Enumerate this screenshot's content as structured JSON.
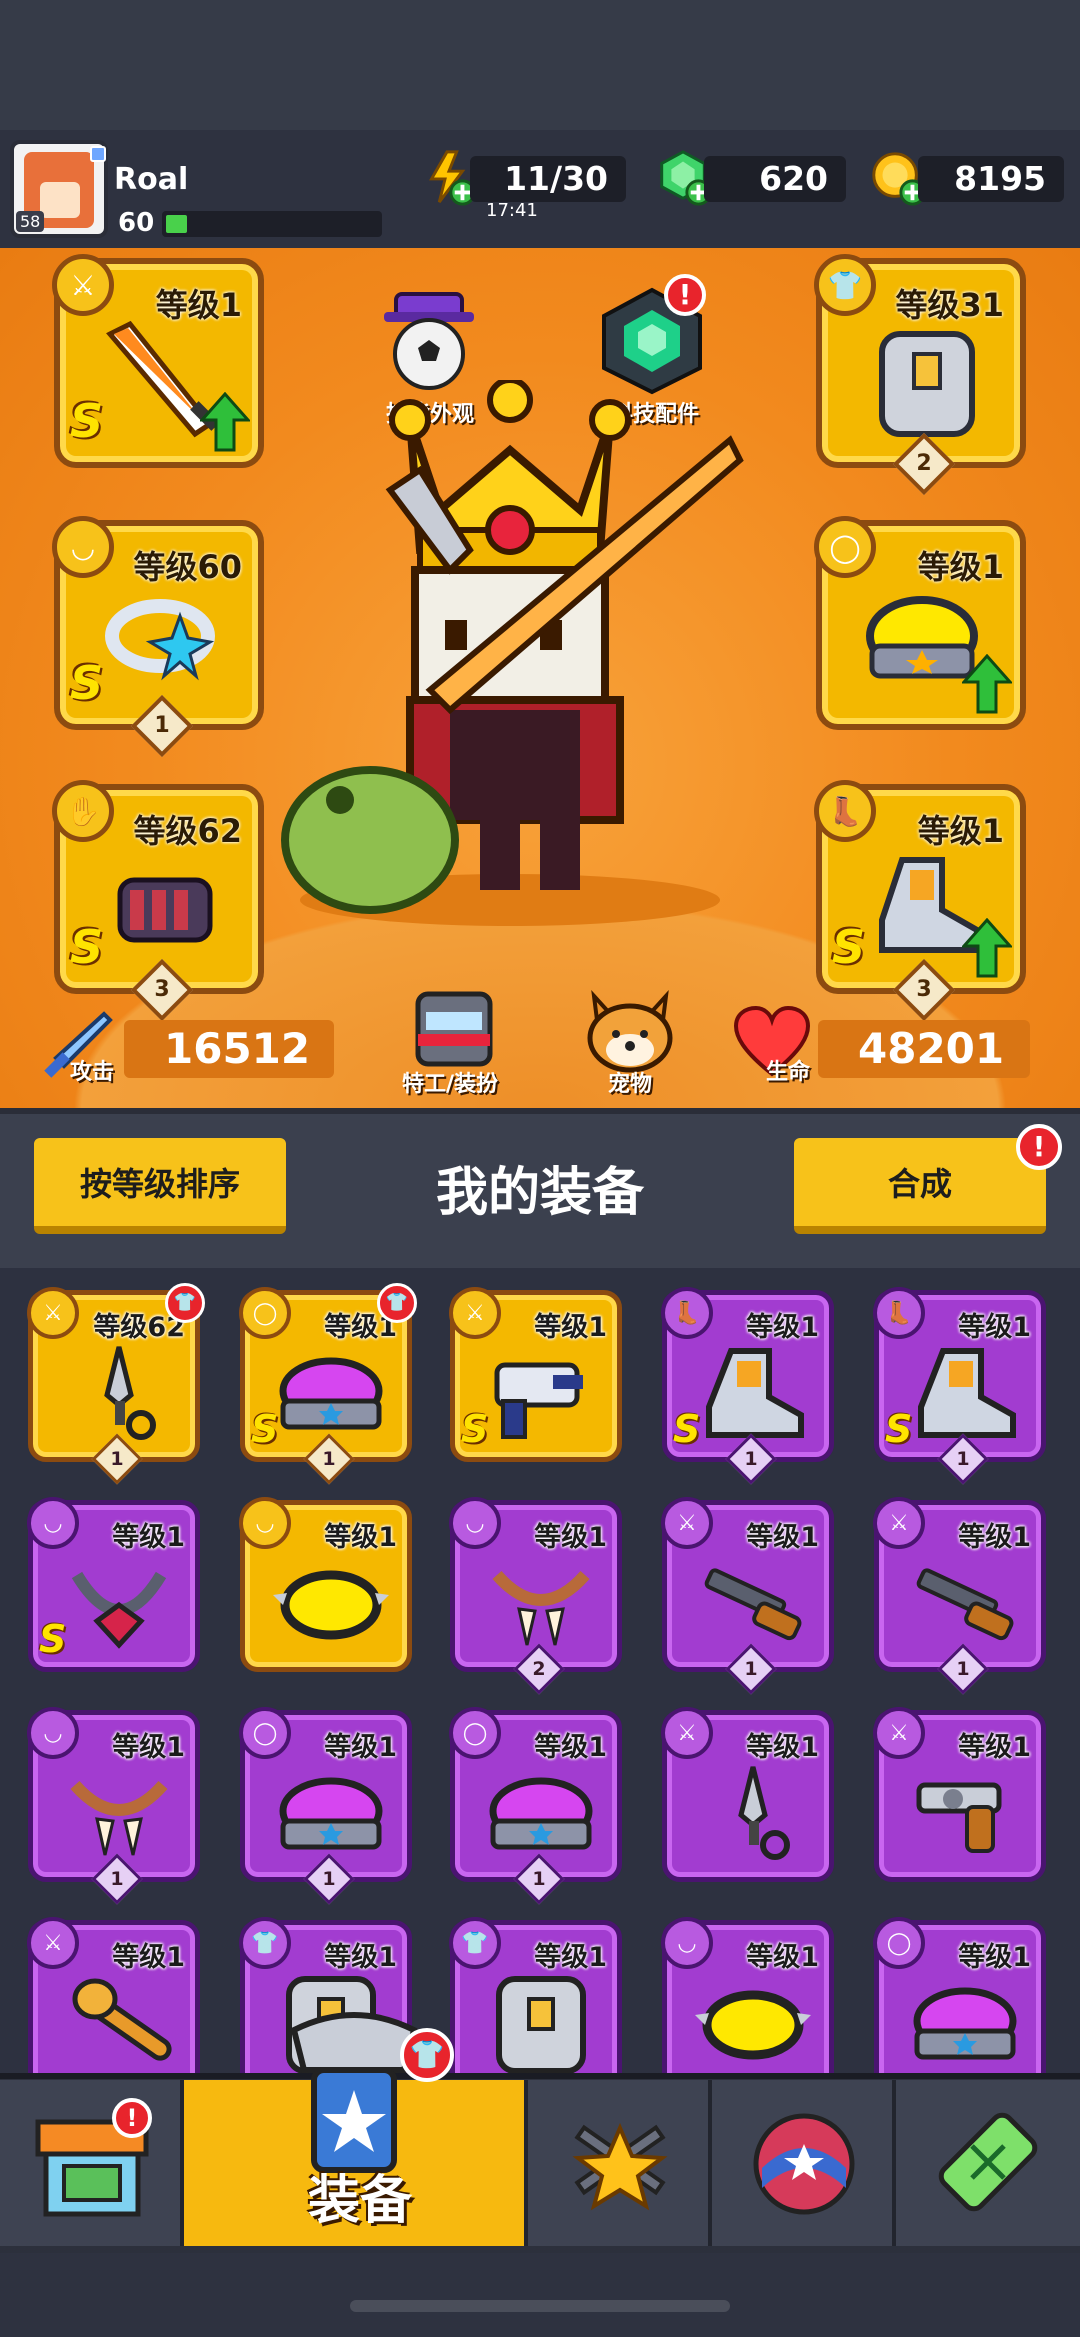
{
  "player": {
    "name": "Roal",
    "level": "60",
    "avatar_badge": "58",
    "xp_fraction": 0.1
  },
  "resources": {
    "energy": "11/30",
    "energy_timer": "17:41",
    "gems": "620",
    "coins": "8195"
  },
  "hero_slots": {
    "weapon": {
      "level": "等级1",
      "rank": "S"
    },
    "necklace": {
      "level": "等级60",
      "rank": "S",
      "count": "1"
    },
    "glove": {
      "level": "等级62",
      "rank": "S",
      "count": "3"
    },
    "armor": {
      "level": "等级31",
      "count": "2"
    },
    "belt": {
      "level": "等级1"
    },
    "boots": {
      "level": "等级1",
      "rank": "S",
      "count": "3"
    }
  },
  "hero_center": {
    "skill_look": "技能外观",
    "tech_parts": "科技配件",
    "agent_outfit": "特工/装扮",
    "pet": "宠物"
  },
  "stats": {
    "attack_label": "攻击",
    "attack_value": "16512",
    "hp_label": "生命",
    "hp_value": "48201"
  },
  "equipment_header": {
    "sort_button": "按等级排序",
    "title": "我的装备",
    "merge_button": "合成",
    "notif": "!"
  },
  "inventory": [
    {
      "level": "等级62",
      "rarity": "gold",
      "rank": "",
      "count": "1",
      "icon": "kunai-icon",
      "type": "weapon"
    },
    {
      "level": "等级1",
      "rarity": "gold",
      "rank": "S",
      "count": "1",
      "icon": "belt-icon",
      "type": "belt"
    },
    {
      "level": "等级1",
      "rarity": "gold",
      "rank": "S",
      "count": "",
      "icon": "blaster-icon",
      "type": "weapon"
    },
    {
      "level": "等级1",
      "rarity": "purple",
      "rank": "S",
      "count": "1",
      "icon": "boots-icon",
      "type": "boots"
    },
    {
      "level": "等级1",
      "rarity": "purple",
      "rank": "S",
      "count": "1",
      "icon": "boots-icon",
      "type": "boots"
    },
    {
      "level": "等级1",
      "rarity": "purple",
      "rank": "S",
      "count": "",
      "icon": "chain-necklace-icon",
      "type": "necklace"
    },
    {
      "level": "等级1",
      "rarity": "gold",
      "rank": "",
      "count": "",
      "icon": "spiked-collar-icon",
      "type": "necklace"
    },
    {
      "level": "等级1",
      "rarity": "purple",
      "rank": "",
      "count": "2",
      "icon": "fang-necklace-icon",
      "type": "necklace"
    },
    {
      "level": "等级1",
      "rarity": "purple",
      "rank": "",
      "count": "1",
      "icon": "shotgun-icon",
      "type": "weapon"
    },
    {
      "level": "等级1",
      "rarity": "purple",
      "rank": "",
      "count": "1",
      "icon": "shotgun-icon",
      "type": "weapon"
    },
    {
      "level": "等级1",
      "rarity": "purple",
      "rank": "",
      "count": "1",
      "icon": "fang-necklace-icon",
      "type": "necklace"
    },
    {
      "level": "等级1",
      "rarity": "purple",
      "rank": "",
      "count": "1",
      "icon": "belt-icon",
      "type": "belt"
    },
    {
      "level": "等级1",
      "rarity": "purple",
      "rank": "",
      "count": "1",
      "icon": "belt-icon",
      "type": "belt"
    },
    {
      "level": "等级1",
      "rarity": "purple",
      "rank": "",
      "count": "",
      "icon": "kunai-icon",
      "type": "weapon"
    },
    {
      "level": "等级1",
      "rarity": "purple",
      "rank": "",
      "count": "",
      "icon": "revolver-icon",
      "type": "weapon"
    },
    {
      "level": "等级1",
      "rarity": "purple",
      "rank": "",
      "count": "",
      "icon": "bat-icon",
      "type": "weapon"
    },
    {
      "level": "等级1",
      "rarity": "purple",
      "rank": "",
      "count": "",
      "icon": "armor-icon",
      "type": "armor"
    },
    {
      "level": "等级1",
      "rarity": "purple",
      "rank": "",
      "count": "",
      "icon": "armor-icon",
      "type": "armor"
    },
    {
      "level": "等级1",
      "rarity": "purple",
      "rank": "",
      "count": "",
      "icon": "spiked-collar-icon",
      "type": "necklace"
    },
    {
      "level": "等级1",
      "rarity": "purple",
      "rank": "",
      "count": "",
      "icon": "belt-icon",
      "type": "belt"
    }
  ],
  "nav": {
    "active_label": "装备",
    "tabs": [
      "shop-icon",
      "equipment-icon",
      "skills-icon",
      "events-icon",
      "lab-icon"
    ]
  },
  "colors": {
    "gold": "#f4b800",
    "purple": "#a23cd0",
    "orange_bg": "#f28a1e",
    "notif_red": "#e8242c"
  }
}
